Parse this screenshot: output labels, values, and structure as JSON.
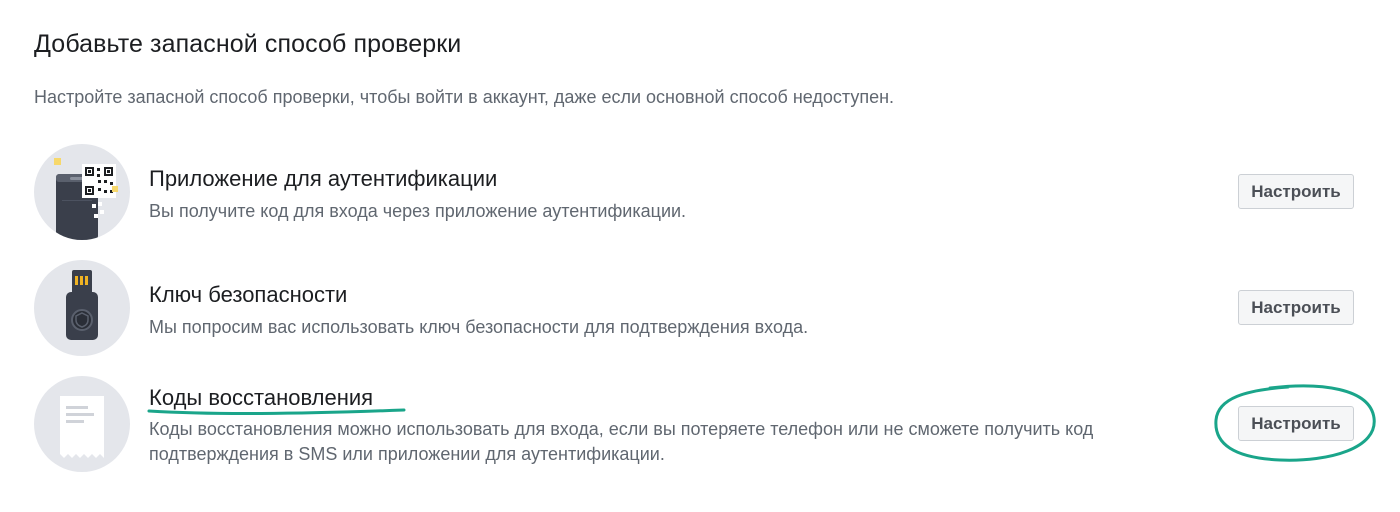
{
  "header": {
    "title": "Добавьте запасной способ проверки",
    "subtitle": "Настройте запасной способ проверки, чтобы войти в аккаунт, даже если основной способ недоступен."
  },
  "options": [
    {
      "icon": "authenticator-app-icon",
      "title": "Приложение для аутентификации",
      "description": "Вы получите код для входа через приложение аутентификации.",
      "button_label": "Настроить"
    },
    {
      "icon": "security-key-icon",
      "title": "Ключ безопасности",
      "description": "Мы попросим вас использовать ключ безопасности для подтверждения входа.",
      "button_label": "Настроить"
    },
    {
      "icon": "recovery-codes-icon",
      "title": "Коды восстановления",
      "description": "Коды восстановления можно использовать для входа, если вы потеряете телефон или не сможете получить код подтверждения в SMS или приложении для аутентификации.",
      "button_label": "Настроить"
    }
  ],
  "colors": {
    "annotation": "#1aa58a",
    "icon_bg": "#e4e6eb",
    "button_bg": "#f5f6f7",
    "secondary_text": "#606770"
  }
}
